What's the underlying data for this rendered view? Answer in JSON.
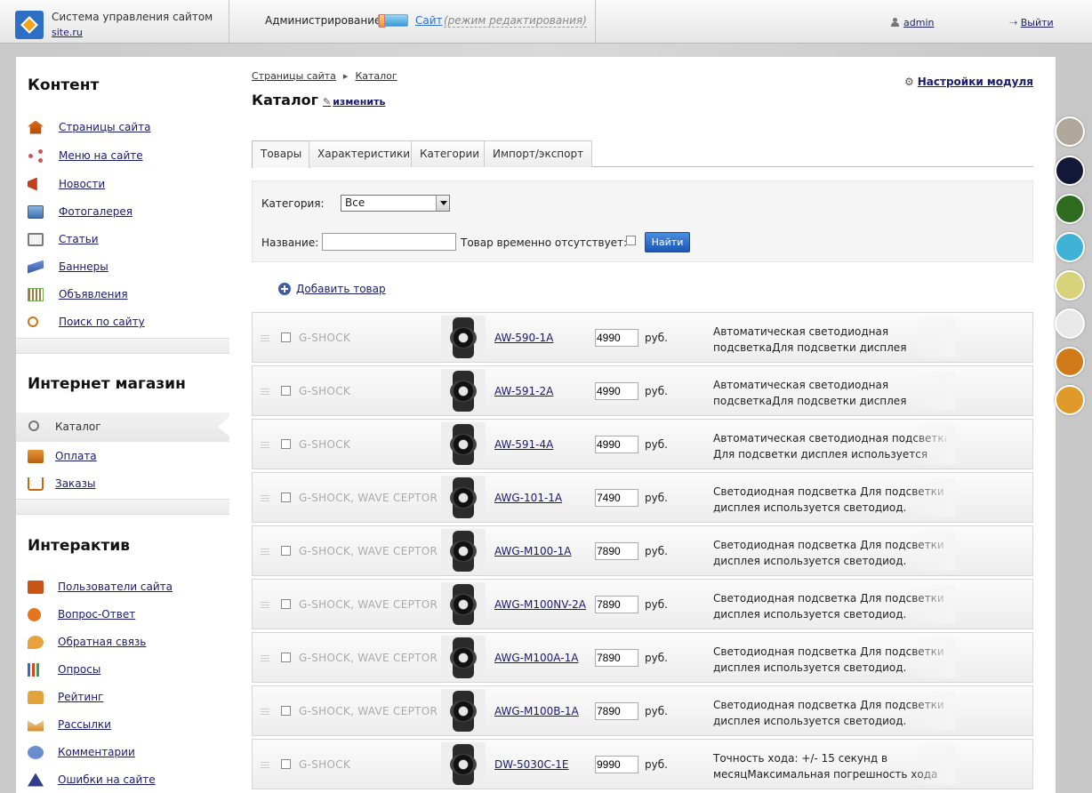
{
  "topbar": {
    "system_name": "Система управления сайтом",
    "site_domain": "site.ru",
    "admin_label": "Администрирование",
    "site_label": "Сайт",
    "site_mode": "(режим редактирования)",
    "user_name": "admin",
    "logout_label": "Выйти"
  },
  "sidebar": {
    "content_title": "Контент",
    "content_items": [
      {
        "label": "Страницы сайта",
        "icon": "home-icon"
      },
      {
        "label": "Меню на сайте",
        "icon": "share-icon"
      },
      {
        "label": "Новости",
        "icon": "megaphone-icon"
      },
      {
        "label": "Фотогалерея",
        "icon": "photo-icon"
      },
      {
        "label": "Статьи",
        "icon": "book-icon"
      },
      {
        "label": "Баннеры",
        "icon": "banner-icon"
      },
      {
        "label": "Объявления",
        "icon": "ads-icon"
      },
      {
        "label": "Поиск по сайту",
        "icon": "search-icon"
      }
    ],
    "shop_title": "Интернет магазин",
    "shop_items": [
      {
        "label": "Каталог",
        "icon": "catalog-icon",
        "active": true
      },
      {
        "label": "Оплата",
        "icon": "payment-icon"
      },
      {
        "label": "Заказы",
        "icon": "cart-icon"
      }
    ],
    "interactive_title": "Интерактив",
    "interactive_items": [
      {
        "label": "Пользователи сайта",
        "icon": "users-icon"
      },
      {
        "label": "Вопрос-Ответ",
        "icon": "question-icon"
      },
      {
        "label": "Обратная связь",
        "icon": "feedback-icon"
      },
      {
        "label": "Опросы",
        "icon": "polls-icon"
      },
      {
        "label": "Рейтинг",
        "icon": "thumbs-up-icon"
      },
      {
        "label": "Рассылки",
        "icon": "mail-icon"
      },
      {
        "label": "Комментарии",
        "icon": "comments-icon"
      },
      {
        "label": "Ошибки на сайте",
        "icon": "warning-icon"
      }
    ]
  },
  "main": {
    "breadcrumb": [
      "Страницы сайта",
      "Каталог"
    ],
    "title": "Каталог",
    "edit_label": "изменить",
    "module_settings_label": "Настройки модуля",
    "tabs": [
      {
        "label": "Товары",
        "active": true
      },
      {
        "label": "Характеристики"
      },
      {
        "label": "Категории"
      },
      {
        "label": "Импорт/экспорт"
      }
    ],
    "filter": {
      "category_label": "Категория:",
      "category_value": "Все",
      "name_label": "Название:",
      "name_value": "",
      "out_of_stock_label": "Товар временно отсутствует:",
      "find_button": "Найти"
    },
    "add_item_label": "Добавить товар",
    "currency": "руб.",
    "products": [
      {
        "brand": "G-SHOCK",
        "sku": "AW-590-1A",
        "price": "4990",
        "desc1": "Автоматическая светодиодная",
        "desc2": "подсветкаДля подсветки дисплея"
      },
      {
        "brand": "G-SHOCK",
        "sku": "AW-591-2A",
        "price": "4990",
        "desc1": "Автоматическая светодиодная",
        "desc2": "подсветкаДля подсветки дисплея"
      },
      {
        "brand": "G-SHOCK",
        "sku": "AW-591-4A",
        "price": "4990",
        "desc1": "Автоматическая светодиодная подсветка",
        "desc2": "Для подсветки дисплея используется"
      },
      {
        "brand": "G-SHOCK, WAVE CEPTOR",
        "sku": "AWG-101-1A",
        "price": "7490",
        "desc1": "Светодиодная подсветка Для подсветки",
        "desc2": "дисплея используется светодиод."
      },
      {
        "brand": "G-SHOCK, WAVE CEPTOR",
        "sku": "AWG-M100-1A",
        "price": "7890",
        "desc1": "Светодиодная подсветка  Для подсветки",
        "desc2": "дисплея используется светодиод."
      },
      {
        "brand": "G-SHOCK, WAVE CEPTOR",
        "sku": "AWG-M100NV-2A",
        "price": "7890",
        "desc1": "Светодиодная подсветка Для подсветки",
        "desc2": "дисплея используется светодиод."
      },
      {
        "brand": "G-SHOCK, WAVE CEPTOR",
        "sku": "AWG-M100A-1A",
        "price": "7890",
        "desc1": "Светодиодная подсветка Для подсветки",
        "desc2": "дисплея используется светодиод."
      },
      {
        "brand": "G-SHOCK, WAVE CEPTOR",
        "sku": "AWG-M100B-1A",
        "price": "7890",
        "desc1": "Светодиодная подсветка Для подсветки",
        "desc2": "дисплея используется светодиод."
      },
      {
        "brand": "G-SHOCK",
        "sku": "DW-5030C-1E",
        "price": "9990",
        "desc1": "Точность хода: +/- 15 секунд в",
        "desc2": "месяцМаксимальная погрешность хода"
      }
    ]
  },
  "theme_circles": [
    "#b0a89a",
    "#141838",
    "#2e6b1e",
    "#3fb2d6",
    "#d8d27a",
    "#e8e8e8",
    "#d07a1a",
    "#e09a2a"
  ]
}
